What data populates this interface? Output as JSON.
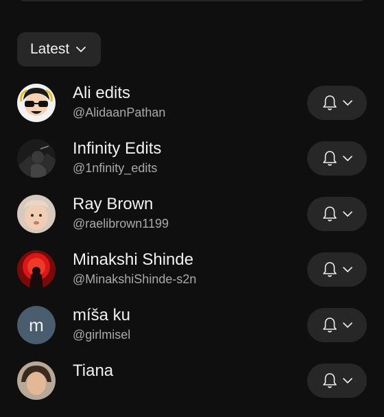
{
  "filter": {
    "sort_label": "Latest"
  },
  "subscriptions": [
    {
      "name": "Ali edits",
      "handle": "@AlidaanPathan",
      "avatar": "cartoon-avatar"
    },
    {
      "name": "Infinity Edits",
      "handle": "@1nfinity_edits",
      "avatar": "dark-photo-avatar"
    },
    {
      "name": "Ray Brown",
      "handle": "@raelibrown1199",
      "avatar": "baby-photo-avatar"
    },
    {
      "name": "Minakshi Shinde",
      "handle": "@MinakshiShinde-s2n",
      "avatar": "red-moon-avatar"
    },
    {
      "name": "míša ku",
      "handle": "@girlmisel",
      "avatar": "letter-avatar",
      "avatar_letter": "m"
    },
    {
      "name": "Tiana",
      "handle": "",
      "avatar": "photo-avatar"
    }
  ],
  "icons": {
    "notification": "bell-icon",
    "expand": "chevron-down-icon"
  },
  "colors": {
    "background": "#0f0f0f",
    "button": "#272727",
    "text_primary": "#f1f1f1",
    "text_secondary": "#aaaaaa",
    "letter_avatar": "#4a5d6e"
  }
}
